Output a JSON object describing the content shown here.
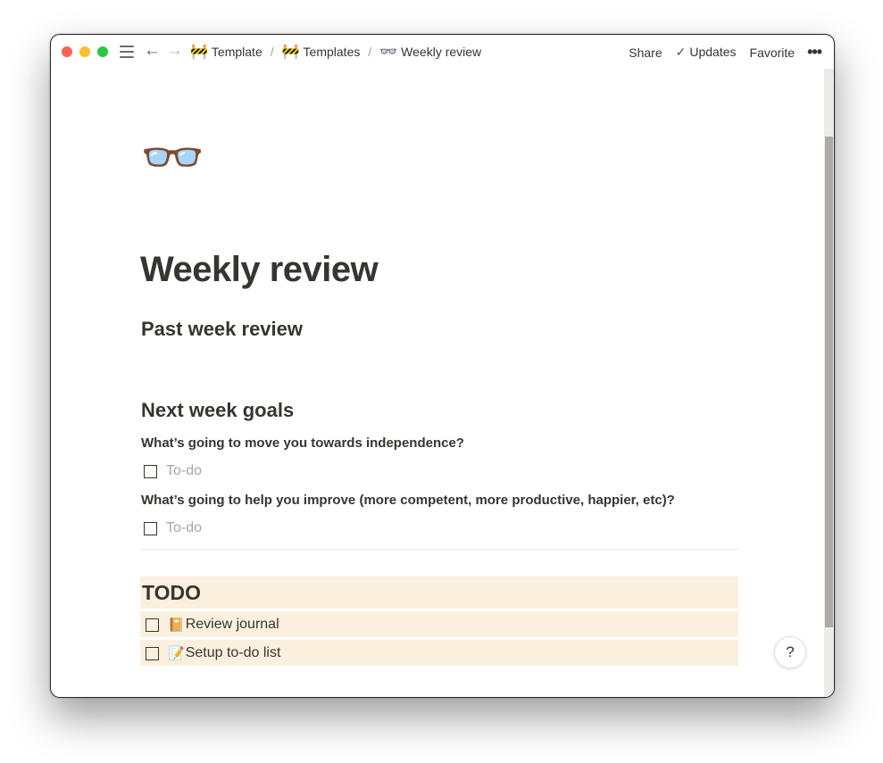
{
  "window": {
    "traffic_lights": [
      "close",
      "minimize",
      "maximize"
    ]
  },
  "topbar": {
    "menu_icon": "hamburger-menu-icon",
    "back_icon": "←",
    "forward_icon": "→",
    "breadcrumbs": [
      {
        "emoji": "🚧",
        "label": "Template"
      },
      {
        "emoji": "🚧",
        "label": "Templates"
      },
      {
        "emoji": "👓",
        "label": "Weekly review"
      }
    ],
    "separator": "/",
    "actions": {
      "share": "Share",
      "updates_check": "✓",
      "updates": "Updates",
      "favorite": "Favorite",
      "more": "•••"
    }
  },
  "page": {
    "icon": "👓",
    "title": "Weekly review",
    "sections": {
      "past_week": "Past week review",
      "next_week": "Next week goals",
      "q1": "What’s going to move you towards independence?",
      "q1_todo_placeholder": "To-do",
      "q2": "What’s going to help you improve (more competent, more productive, happier, etc)?",
      "q2_todo_placeholder": "To-do"
    },
    "todo_block": {
      "heading": "TODO",
      "background": "#fbf0de",
      "items": [
        {
          "emoji": "📔",
          "label": "Review journal",
          "checked": false
        },
        {
          "emoji": "📝",
          "label": "Setup to-do list",
          "checked": false
        }
      ]
    }
  },
  "help_button": "?"
}
